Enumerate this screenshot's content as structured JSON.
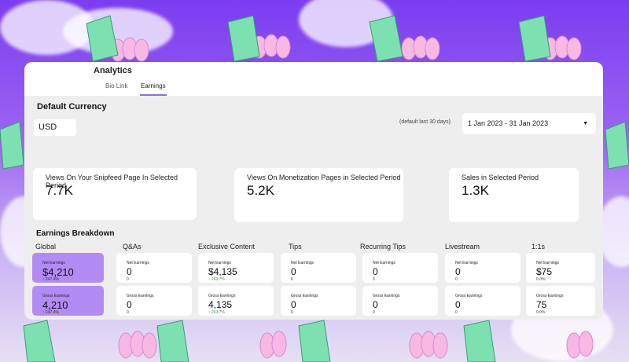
{
  "header": {
    "title": "Analytics",
    "tabs": [
      {
        "label": "Bio Link",
        "active": false
      },
      {
        "label": "Earnings",
        "active": true
      }
    ]
  },
  "currency": {
    "heading": "Default Currency",
    "value": "USD"
  },
  "date_filter": {
    "hint": "(default last 30 days)",
    "value": "1 Jan 2023 - 31 Jan 2023"
  },
  "stats": [
    {
      "label": "Views On Your Snipfeed Page In Selected Period",
      "value": "7.7K"
    },
    {
      "label": "Views On Monetization Pages in Selected Period",
      "value": "5.2K"
    },
    {
      "label": "Sales in Selected Period",
      "value": "1.3K"
    }
  ],
  "breakdown": {
    "heading": "Earnings Breakdown",
    "columns": [
      {
        "title": "Global",
        "net": {
          "label": "Net Earnings",
          "value": "$4,210",
          "change": "↑ 247.4%"
        },
        "gross": {
          "label": "Gross Earnings",
          "value": "4,210",
          "change": "↑ 247.4%"
        }
      },
      {
        "title": "Q&As",
        "net": {
          "label": "Net Earnings",
          "value": "0",
          "change": "0"
        },
        "gross": {
          "label": "Gross Earnings",
          "value": "0",
          "change": "0"
        }
      },
      {
        "title": "Exclusive Content",
        "net": {
          "label": "Net Earnings",
          "value": "$4,135",
          "change": "↑ 263.7%"
        },
        "gross": {
          "label": "Gross Earnings",
          "value": "4,135",
          "change": "↑ 263.7%"
        }
      },
      {
        "title": "Tips",
        "net": {
          "label": "Net Earnings",
          "value": "0",
          "change": "0"
        },
        "gross": {
          "label": "Gross Earnings",
          "value": "0",
          "change": "0"
        }
      },
      {
        "title": "Recurring Tips",
        "net": {
          "label": "Net Earnings",
          "value": "0",
          "change": "0"
        },
        "gross": {
          "label": "Gross Earnings",
          "value": "0",
          "change": "0"
        }
      },
      {
        "title": "Livestream",
        "net": {
          "label": "Net Earnings",
          "value": "0",
          "change": "0"
        },
        "gross": {
          "label": "Gross Earnings",
          "value": "0",
          "change": "0"
        }
      },
      {
        "title": "1:1s",
        "net": {
          "label": "Net Earnings",
          "value": "$75",
          "change": "0.0%"
        },
        "gross": {
          "label": "Gross Earnings",
          "value": "75",
          "change": "0.0%"
        }
      }
    ]
  },
  "colors": {
    "highlight_card": "#b38bf5",
    "tab_underline": "#8f6ed8",
    "positive_change": "#2e9e4d"
  }
}
